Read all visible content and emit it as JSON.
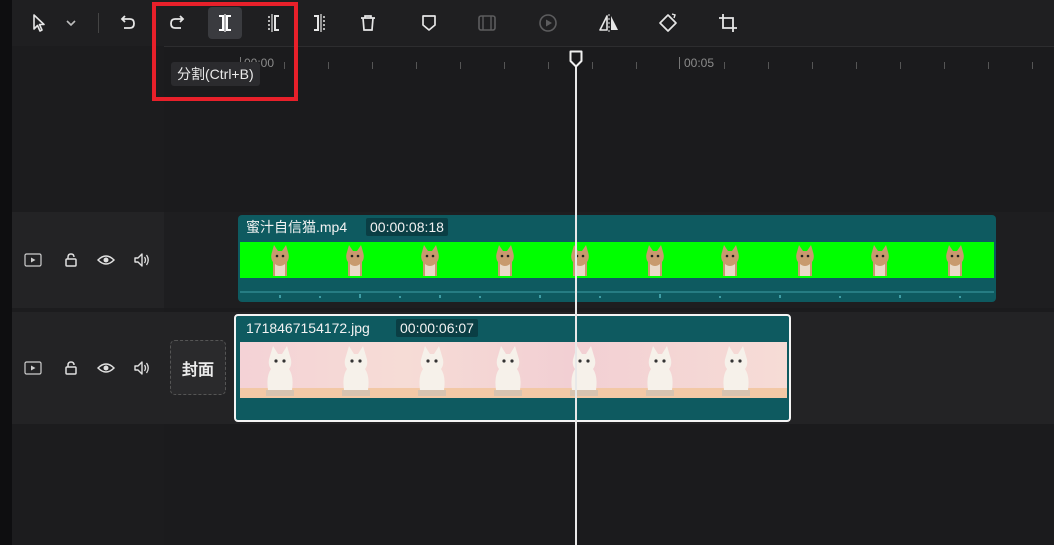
{
  "toolbar": {
    "tools": [
      {
        "icon": "select-pointer-icon"
      },
      {
        "icon": "chevron-down-icon"
      },
      {
        "icon": "undo-icon"
      },
      {
        "icon": "redo-icon"
      },
      {
        "icon": "split-icon",
        "active": true
      },
      {
        "icon": "split-left-icon"
      },
      {
        "icon": "split-right-icon"
      },
      {
        "icon": "delete-icon"
      },
      {
        "icon": "marker-icon"
      },
      {
        "icon": "freeze-frame-icon",
        "disabled": true
      },
      {
        "icon": "reverse-play-icon",
        "disabled": true
      },
      {
        "icon": "mirror-icon"
      },
      {
        "icon": "rotate-icon"
      },
      {
        "icon": "crop-icon"
      }
    ],
    "tooltip": "分割(Ctrl+B)"
  },
  "ruler": {
    "labels": [
      "00:00",
      "00:05"
    ]
  },
  "tracks": [
    {
      "controls": [
        "video-track-icon",
        "lock-icon",
        "eye-icon",
        "volume-icon"
      ],
      "clip": {
        "name": "蜜汁自信猫.mp4",
        "duration": "00:00:08:18"
      }
    },
    {
      "controls": [
        "video-track-icon",
        "lock-icon",
        "eye-icon",
        "volume-icon"
      ],
      "clip": {
        "name": "1718467154172.jpg",
        "duration": "00:00:06:07"
      },
      "cover_label": "封面"
    }
  ],
  "colors": {
    "highlight": "#e8202a",
    "clip_bg": "#0e5a60",
    "green_screen": "#00ff00"
  }
}
